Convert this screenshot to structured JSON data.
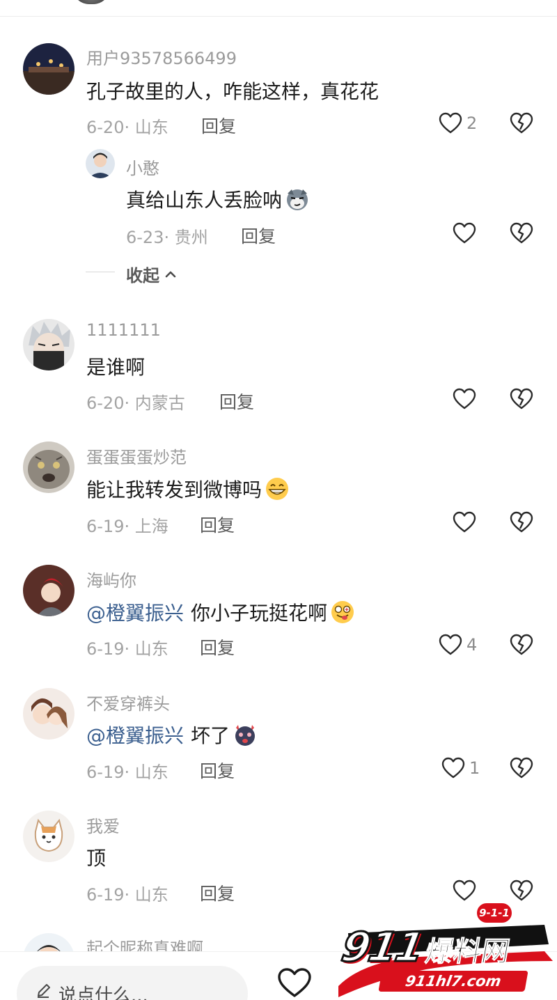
{
  "comments": [
    {
      "username": "用户93578566499",
      "text": "孔子故里的人，咋能这样，真花花",
      "date_location": "6-20· 山东",
      "reply_label": "回复",
      "like_count": "2",
      "replies": [
        {
          "username": "小憨",
          "text": "真给山东人丢脸呐",
          "emoji": "smirk-face-emoji",
          "date_location": "6-23· 贵州",
          "reply_label": "回复",
          "like_count": ""
        }
      ],
      "collapse_label": "收起"
    },
    {
      "username": "1111111",
      "text": "是谁啊",
      "date_location": "6-20· 内蒙古",
      "reply_label": "回复",
      "like_count": ""
    },
    {
      "username": "蛋蛋蛋蛋炒范",
      "text": "能让我转发到微博吗",
      "emoji": "grinning-face-emoji",
      "date_location": "6-19· 上海",
      "reply_label": "回复",
      "like_count": ""
    },
    {
      "username": "海屿你",
      "mention": "@橙翼振兴",
      "text": "你小子玩挺花啊",
      "emoji": "starstruck-tongue-emoji",
      "date_location": "6-19· 山东",
      "reply_label": "回复",
      "like_count": "4"
    },
    {
      "username": "不爱穿裤头",
      "mention": "@橙翼振兴",
      "text": "坏了",
      "emoji": "devil-face-emoji",
      "date_location": "6-19· 山东",
      "reply_label": "回复",
      "like_count": "1"
    },
    {
      "username": "我爱",
      "text": "顶",
      "date_location": "6-19· 山东",
      "reply_label": "回复",
      "like_count": ""
    },
    {
      "username": "起个昵称真难啊"
    }
  ],
  "input": {
    "placeholder": "说点什么..."
  },
  "watermark": {
    "badge": "9-1-1",
    "brand_number": "911",
    "brand_text": "爆料网",
    "url": "911hl7.com"
  },
  "colors": {
    "mention": "#3b5f8f",
    "meta": "#a3a3a3",
    "watermark_red": "#d9101c"
  }
}
